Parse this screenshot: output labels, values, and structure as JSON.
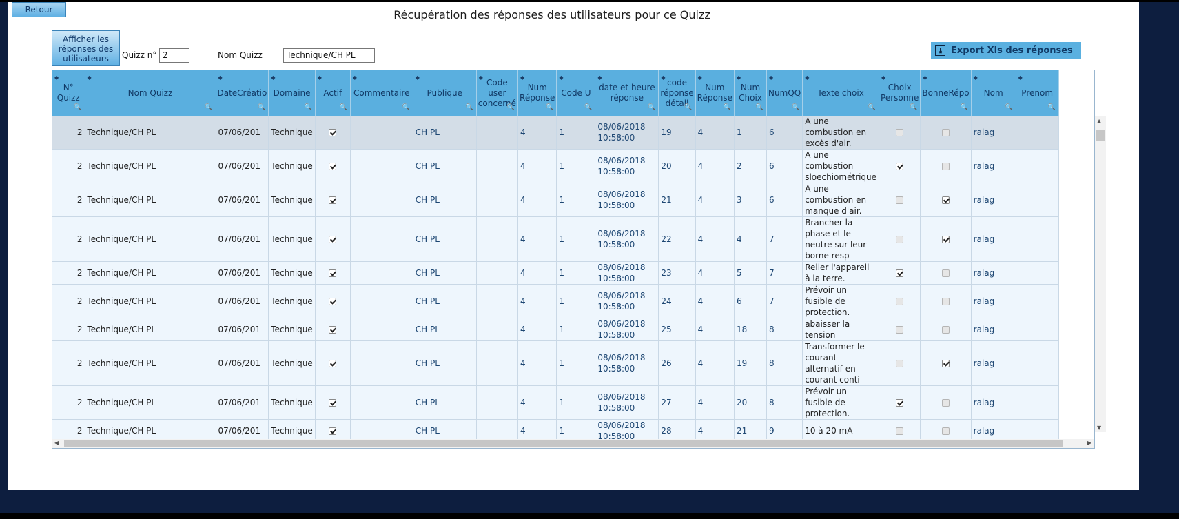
{
  "window": {
    "title": "Récupération des réponses des utilisateurs pour ce Quizz"
  },
  "toolbar": {
    "back_label": "Retour",
    "show_label": "Afficher les réponses des utilisateurs",
    "quiz_no_label": "Quizz n°",
    "quiz_no_value": "2",
    "quiz_name_label": "Nom Quizz",
    "quiz_name_value": "Technique/CH PL",
    "export_label": "Export Xls des réponses",
    "export_icon": "download-icon"
  },
  "colors": {
    "header_bg": "#5aafdf",
    "row_bg": "#eef6fd",
    "selected_row_bg": "#d3dde7",
    "button_bg": "#5ab0e0"
  },
  "grid": {
    "columns": [
      "N° Quizz",
      "Nom Quizz",
      "DateCréatio",
      "Domaine",
      "Actif",
      "Commentaire",
      "Publique",
      "Code user concerné",
      "Num Réponse",
      "Code U",
      "date et heure réponse",
      "code réponse détail",
      "Num Réponse",
      "Num Choix",
      "NumQQ",
      "Texte choix",
      "Choix Personne",
      "BonneRépo",
      "Nom",
      "Prenom"
    ],
    "rows": [
      {
        "quiz": "2",
        "name": "Technique/CH PL",
        "date": "07/06/201",
        "domain": "Technique",
        "active": true,
        "publique": "CH PL",
        "num_rep": "4",
        "code_u": "1",
        "datetime": "08/06/2018 10:58:00",
        "code_det": "19",
        "num_rep2": "4",
        "num_choix": "1",
        "numqq": "6",
        "texte": "A une combustion en excès d'air.",
        "choix_perso": false,
        "bonne": false,
        "nom": "ralag",
        "selected": true
      },
      {
        "quiz": "2",
        "name": "Technique/CH PL",
        "date": "07/06/201",
        "domain": "Technique",
        "active": true,
        "publique": "CH PL",
        "num_rep": "4",
        "code_u": "1",
        "datetime": "08/06/2018 10:58:00",
        "code_det": "20",
        "num_rep2": "4",
        "num_choix": "2",
        "numqq": "6",
        "texte": "A une combustion sloechiométrique",
        "choix_perso": true,
        "bonne": false,
        "nom": "ralag",
        "selected": false
      },
      {
        "quiz": "2",
        "name": "Technique/CH PL",
        "date": "07/06/201",
        "domain": "Technique",
        "active": true,
        "publique": "CH PL",
        "num_rep": "4",
        "code_u": "1",
        "datetime": "08/06/2018 10:58:00",
        "code_det": "21",
        "num_rep2": "4",
        "num_choix": "3",
        "numqq": "6",
        "texte": "A une combustion en manque d'air.",
        "choix_perso": false,
        "bonne": true,
        "nom": "ralag",
        "selected": false
      },
      {
        "quiz": "2",
        "name": "Technique/CH PL",
        "date": "07/06/201",
        "domain": "Technique",
        "active": true,
        "publique": "CH PL",
        "num_rep": "4",
        "code_u": "1",
        "datetime": "08/06/2018 10:58:00",
        "code_det": "22",
        "num_rep2": "4",
        "num_choix": "4",
        "numqq": "7",
        "texte": "Brancher la phase et le neutre sur leur borne resp",
        "choix_perso": false,
        "bonne": true,
        "nom": "ralag",
        "selected": false
      },
      {
        "quiz": "2",
        "name": "Technique/CH PL",
        "date": "07/06/201",
        "domain": "Technique",
        "active": true,
        "publique": "CH PL",
        "num_rep": "4",
        "code_u": "1",
        "datetime": "08/06/2018 10:58:00",
        "code_det": "23",
        "num_rep2": "4",
        "num_choix": "5",
        "numqq": "7",
        "texte": "Relier l'appareil à la terre.",
        "choix_perso": true,
        "bonne": false,
        "nom": "ralag",
        "selected": false
      },
      {
        "quiz": "2",
        "name": "Technique/CH PL",
        "date": "07/06/201",
        "domain": "Technique",
        "active": true,
        "publique": "CH PL",
        "num_rep": "4",
        "code_u": "1",
        "datetime": "08/06/2018 10:58:00",
        "code_det": "24",
        "num_rep2": "4",
        "num_choix": "6",
        "numqq": "7",
        "texte": "Prévoir un fusible de protection.",
        "choix_perso": false,
        "bonne": false,
        "nom": "ralag",
        "selected": false
      },
      {
        "quiz": "2",
        "name": "Technique/CH PL",
        "date": "07/06/201",
        "domain": "Technique",
        "active": true,
        "publique": "CH PL",
        "num_rep": "4",
        "code_u": "1",
        "datetime": "08/06/2018 10:58:00",
        "code_det": "25",
        "num_rep2": "4",
        "num_choix": "18",
        "numqq": "8",
        "texte": "abaisser la tension",
        "choix_perso": false,
        "bonne": false,
        "nom": "ralag",
        "selected": false
      },
      {
        "quiz": "2",
        "name": "Technique/CH PL",
        "date": "07/06/201",
        "domain": "Technique",
        "active": true,
        "publique": "CH PL",
        "num_rep": "4",
        "code_u": "1",
        "datetime": "08/06/2018 10:58:00",
        "code_det": "26",
        "num_rep2": "4",
        "num_choix": "19",
        "numqq": "8",
        "texte": "Transformer le courant alternatif en courant conti",
        "choix_perso": false,
        "bonne": true,
        "nom": "ralag",
        "selected": false
      },
      {
        "quiz": "2",
        "name": "Technique/CH PL",
        "date": "07/06/201",
        "domain": "Technique",
        "active": true,
        "publique": "CH PL",
        "num_rep": "4",
        "code_u": "1",
        "datetime": "08/06/2018 10:58:00",
        "code_det": "27",
        "num_rep2": "4",
        "num_choix": "20",
        "numqq": "8",
        "texte": "Prévoir un fusible de protection.",
        "choix_perso": true,
        "bonne": false,
        "nom": "ralag",
        "selected": false
      },
      {
        "quiz": "2",
        "name": "Technique/CH PL",
        "date": "07/06/201",
        "domain": "Technique",
        "active": true,
        "publique": "CH PL",
        "num_rep": "4",
        "code_u": "1",
        "datetime": "08/06/2018 10:58:00",
        "code_det": "28",
        "num_rep2": "4",
        "num_choix": "21",
        "numqq": "9",
        "texte": "10 à 20 mA",
        "choix_perso": false,
        "bonne": false,
        "nom": "ralag",
        "selected": false
      }
    ]
  }
}
